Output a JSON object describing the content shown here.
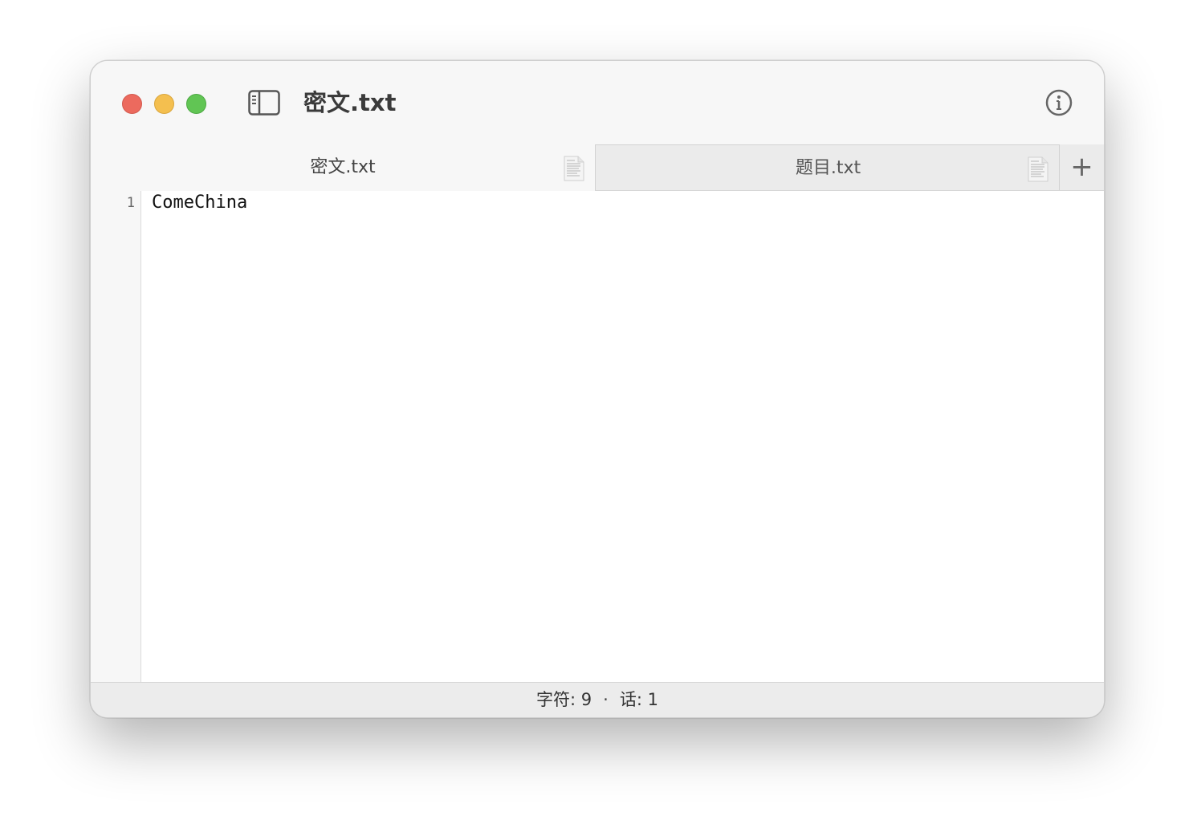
{
  "window": {
    "title": "密文.txt"
  },
  "traffic_lights": {
    "close_color": "#ec6a5e",
    "minimize_color": "#f4bf4f",
    "maximize_color": "#61c554"
  },
  "icons": {
    "sidebar": "sidebar-icon",
    "info": "info-icon",
    "document": "document-icon",
    "add": "plus-icon"
  },
  "tabs": [
    {
      "label": "密文.txt",
      "active": true
    },
    {
      "label": "题目.txt",
      "active": false
    }
  ],
  "tabbar": {
    "add_label": "+"
  },
  "editor": {
    "lines": [
      {
        "number": "1",
        "text": "ComeChina"
      }
    ]
  },
  "status": {
    "characters": "字符: 9",
    "separator": "·",
    "words": "话: 1"
  }
}
